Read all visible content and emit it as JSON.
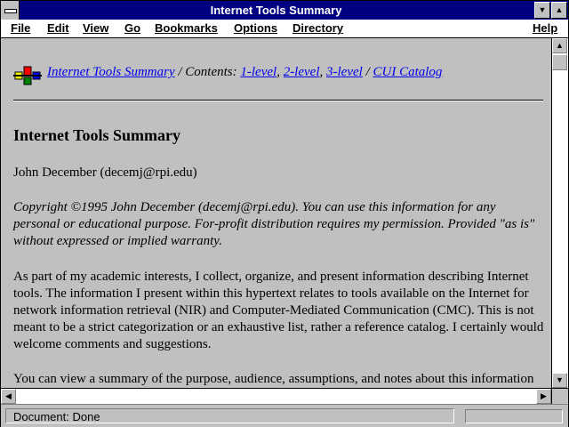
{
  "window": {
    "title": "Internet Tools Summary"
  },
  "titlebar_buttons": {
    "minimize": "▼",
    "maximize": "▲"
  },
  "menu": [
    "File",
    "Edit",
    "View",
    "Go",
    "Bookmarks",
    "Options",
    "Directory",
    "Help"
  ],
  "nav": {
    "home_link": "Internet Tools Summary",
    "contents_label": " / Contents: ",
    "level1": "1-level",
    "sep1": ", ",
    "level2": "2-level",
    "sep2": ", ",
    "level3": "3-level",
    "sep3": " / ",
    "catalog": "CUI Catalog"
  },
  "heading": "Internet Tools Summary",
  "author": "John December (decemj@rpi.edu)",
  "copyright": "Copyright ©1995 John December (decemj@rpi.edu). You can use this information for any personal or educational purpose. For-profit distribution requires my permission. Provided \"as is\" without expressed or implied warranty.",
  "intro": "As part of my academic interests, I collect, organize, and present information describing Internet tools. The information I present within this hypertext relates to tools available on the Internet for network information retrieval (NIR) and Computer-Mediated Communication (CMC). This is not meant to be a strict categorization or an exhaustive list, rather a reference catalog. I certainly would welcome comments and suggestions.",
  "view_summary": "You can view a summary of the purpose, audience, assumptions, and notes about this information",
  "scroll": {
    "up": "▲",
    "down": "▼",
    "left": "◀",
    "right": "▶"
  },
  "status": {
    "text": "Document: Done"
  }
}
